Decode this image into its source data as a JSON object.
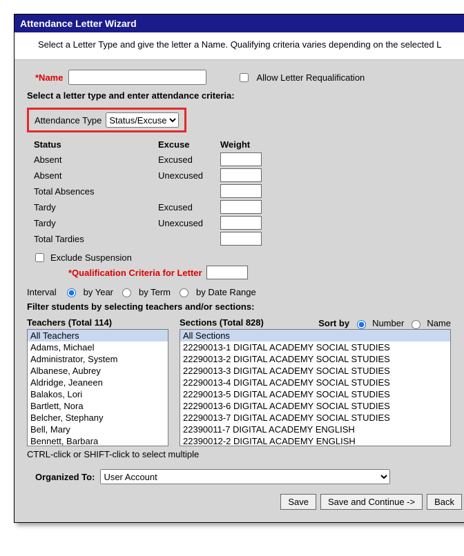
{
  "window_title": "Attendance Letter Wizard",
  "intro_text": "Select a Letter Type and give the letter a Name. Qualifying criteria varies depending on the selected L",
  "fields": {
    "name_label": "*Name",
    "name_value": "",
    "allow_requal_label": "Allow Letter Requalification",
    "type_heading": "Select a letter type and enter attendance criteria:",
    "attendance_type_label": "Attendance Type",
    "attendance_type_value": "Status/Excuse"
  },
  "criteria": {
    "headers": {
      "status": "Status",
      "excuse": "Excuse",
      "weight": "Weight"
    },
    "rows": [
      {
        "status": "Absent",
        "excuse": "Excused"
      },
      {
        "status": "Absent",
        "excuse": "Unexcused"
      },
      {
        "status": "Total Absences",
        "excuse": ""
      },
      {
        "status": "Tardy",
        "excuse": "Excused"
      },
      {
        "status": "Tardy",
        "excuse": "Unexcused"
      },
      {
        "status": "Total Tardies",
        "excuse": ""
      }
    ],
    "exclude_suspension_label": "Exclude Suspension",
    "qualification_label": "*Qualification Criteria for Letter"
  },
  "interval": {
    "label": "Interval",
    "by_year": "by Year",
    "by_term": "by Term",
    "by_date_range": "by Date Range",
    "selected": "by_year"
  },
  "filter_heading": "Filter students by selecting teachers and/or sections:",
  "teachers": {
    "header": "Teachers (Total 114)",
    "items": [
      "All Teachers",
      "Adams, Michael",
      "Administrator, System",
      "Albanese, Aubrey",
      "Aldridge, Jeaneen",
      "Balakos, Lori",
      "Bartlett, Nora",
      "Belcher, Stephany",
      "Bell, Mary",
      "Bennett, Barbara"
    ],
    "selected_index": 0
  },
  "sections": {
    "header": "Sections (Total 828)",
    "sortby_label": "Sort by",
    "sort_number": "Number",
    "sort_name": "Name",
    "sort_selected": "number",
    "items": [
      "All Sections",
      "22290013-1 DIGITAL ACADEMY SOCIAL STUDIES",
      "22290013-2 DIGITAL ACADEMY SOCIAL STUDIES",
      "22290013-3 DIGITAL ACADEMY SOCIAL STUDIES",
      "22290013-4 DIGITAL ACADEMY SOCIAL STUDIES",
      "22290013-5 DIGITAL ACADEMY SOCIAL STUDIES",
      "22290013-6 DIGITAL ACADEMY SOCIAL STUDIES",
      "22290013-7 DIGITAL ACADEMY SOCIAL STUDIES",
      "22390011-7 DIGITAL ACADEMY ENGLISH",
      "22390012-2 DIGITAL ACADEMY ENGLISH"
    ],
    "selected_index": 0
  },
  "multi_hint": "CTRL-click or SHIFT-click to select multiple",
  "organized": {
    "label": "Organized To:",
    "value": "User Account"
  },
  "buttons": {
    "save": "Save",
    "save_continue": "Save and Continue ->",
    "back": "Back"
  }
}
